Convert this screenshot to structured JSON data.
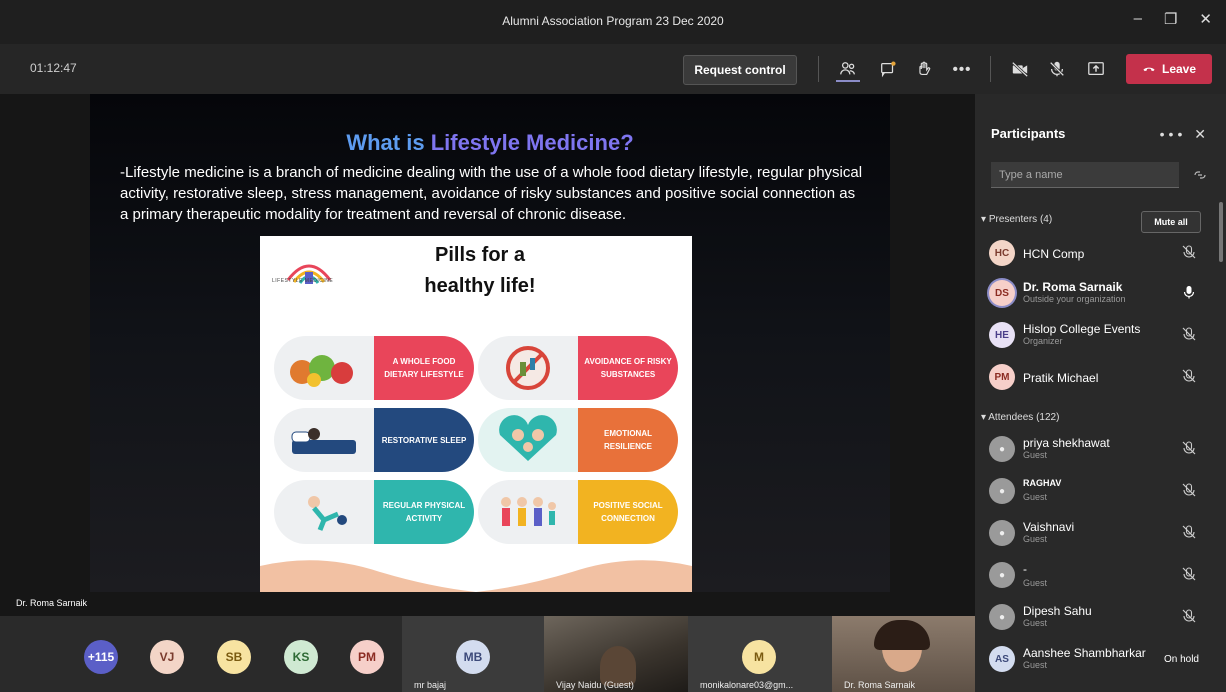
{
  "window": {
    "title": "Alumni Association Program 23 Dec 2020",
    "controls": [
      "minimize-icon",
      "restore-icon",
      "close-icon"
    ]
  },
  "toolbar": {
    "timer": "01:12:47",
    "request_control": "Request control",
    "icons": [
      "participants-icon",
      "chat-icon",
      "raise-hand-icon",
      "more-icon",
      "camera-off-icon",
      "mic-off-icon",
      "share-tray-icon"
    ],
    "leave_label": "Leave",
    "leave_color": "#c4314b"
  },
  "slide": {
    "title_part1": "What is ",
    "title_part2": "Lifestyle Medicine?",
    "body": "-Lifestyle medicine is a branch of medicine dealing with the use of a whole food dietary lifestyle, regular physical activity, restorative sleep, stress management, avoidance of risky substances and positive social connection as a primary therapeutic modality for treatment and reversal of chronic disease.",
    "poster": {
      "title_line1": "Pills for a",
      "title_line2": "healthy life!",
      "logo_text": "LIFESTYLE MEDICINE",
      "pills": [
        {
          "label": "A WHOLE FOOD DIETARY LIFESTYLE",
          "color": "#e9455a"
        },
        {
          "label": "AVOIDANCE OF RISKY SUBSTANCES",
          "color": "#e9455a"
        },
        {
          "label": "RESTORATIVE SLEEP",
          "color": "#23497e"
        },
        {
          "label": "EMOTIONAL RESILIENCE",
          "color": "#e8713a"
        },
        {
          "label": "REGULAR PHYSICAL ACTIVITY",
          "color": "#2fb6ad"
        },
        {
          "label": "POSITIVE SOCIAL CONNECTION",
          "color": "#f2b321"
        }
      ]
    }
  },
  "stage": {
    "speaker_name": "Dr. Roma Sarnaik"
  },
  "gallery": {
    "avatars": [
      {
        "initials": "+115",
        "color": "#5b5fc7",
        "text": "#ffffff"
      },
      {
        "initials": "VJ",
        "color": "#f3d5c7",
        "text": "#7a3b2e"
      },
      {
        "initials": "SB",
        "color": "#f7e3a1",
        "text": "#7a5a10"
      },
      {
        "initials": "KS",
        "color": "#cfe9d2",
        "text": "#2e6a35"
      },
      {
        "initials": "PM",
        "color": "#f6cfc9",
        "text": "#8b2b22"
      }
    ],
    "tiles": [
      {
        "initials": "MB",
        "name": "mr bajaj"
      },
      {
        "initials": "",
        "name": "Vijay Naidu (Guest)"
      },
      {
        "initials": "M",
        "name": "monikalonare03@gm..."
      },
      {
        "initials": "",
        "name": "Dr. Roma Sarnaik"
      }
    ]
  },
  "participants": {
    "title": "Participants",
    "search_placeholder": "Type a name",
    "presenters_heading": "Presenters (4)",
    "mute_all": "Mute all",
    "attendees_heading": "Attendees (122)",
    "presenters": [
      {
        "initials": "HC",
        "name": "HCN Comp",
        "sub": "",
        "color": "#f3d5c7",
        "mic": "mic-off-icon"
      },
      {
        "initials": "DS",
        "name": "Dr. Roma Sarnaik",
        "sub": "Outside your organization",
        "color": "#f6cfc9",
        "mic": "mic-on-icon"
      },
      {
        "initials": "HE",
        "name": "Hislop College Events",
        "sub": "Organizer",
        "color": "#e8e1f5",
        "mic": "mic-off-icon"
      },
      {
        "initials": "PM",
        "name": "Pratik Michael",
        "sub": "",
        "color": "#f6cfc9",
        "mic": "mic-off-icon"
      }
    ],
    "attendees": [
      {
        "initials": "",
        "name": "priya shekhawat",
        "sub": "Guest",
        "mic": "mic-off-icon"
      },
      {
        "initials": "",
        "name": "RAGHAV",
        "sub": "Guest",
        "mic": "mic-off-icon"
      },
      {
        "initials": "",
        "name": "Vaishnavi",
        "sub": "Guest",
        "mic": "mic-off-icon"
      },
      {
        "initials": "",
        "name": "-",
        "sub": "Guest",
        "mic": "mic-off-icon"
      },
      {
        "initials": "",
        "name": "Dipesh Sahu",
        "sub": "Guest",
        "mic": "mic-off-icon"
      },
      {
        "initials": "AS",
        "name": "Aanshee Shambharkar",
        "sub": "Guest",
        "status": "On hold"
      }
    ]
  }
}
